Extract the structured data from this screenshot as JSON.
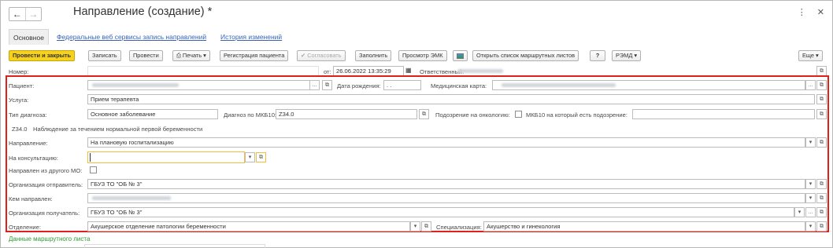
{
  "window": {
    "title": "Направление (создание) *",
    "nav_back_icon": "arrow-left-icon",
    "nav_forward_icon": "arrow-right-icon",
    "menu_glyph": "⋮",
    "close_glyph": "✕"
  },
  "tabs": {
    "main": "Основное",
    "fed": "Федеральные веб сервисы запись направлений",
    "history": "История изменений"
  },
  "toolbar": {
    "post_close": "Провести и закрыть",
    "save": "Записать",
    "post": "Провести",
    "print": "Печать",
    "register_patient": "Регистрация пациента",
    "agree": "Согласовать",
    "fill": "Заполнить",
    "view_emk": "Просмотр ЭМК",
    "open_routes": "Открыть список маршрутных листов",
    "help": "?",
    "remd": "РЭМД",
    "more": "Еще"
  },
  "header_row": {
    "number_label": "Номер:",
    "from_label": "от:",
    "datetime": "26.06.2022 13:35:29",
    "responsible_label": "Ответственный:"
  },
  "form": {
    "patient_label": "Пациент:",
    "birth_label": "Дата рождения:",
    "birth_value": ". .",
    "medcard_label": "Медицинская карта:",
    "service_label": "Услуга:",
    "service_value": "Прием терапевта",
    "diag_type_label": "Тип диагноза:",
    "diag_type_value": "Основное заболевание",
    "mkb_label": "Диагноз по МКБ10:",
    "mkb_value": "Z34.0",
    "onco_label": "Подозрение на онкологию:",
    "onco_mkb_label": "МКБ10 на который есть подозрение:",
    "diag_code": "Z34.0",
    "diag_text": "Наблюдение за течением нормальной первой беременности",
    "direction_label": "Направление:",
    "direction_value": "На плановую госпитализацию",
    "consult_label": "На консультацию:",
    "consult_value": "",
    "from_other_label": "Направлен из другого МО:",
    "org_sender_label": "Организация отправитель:",
    "org_sender_value": "ГБУЗ ТО \"ОБ № 3\"",
    "directed_by_label": "Кем направлен:",
    "org_receiver_label": "Организация получатель:",
    "org_receiver_value": "ГБУЗ ТО \"ОБ № 3\"",
    "dept_label": "Отделение:",
    "dept_value": "Акушерское отделение патологии беременности",
    "spec_label": "Специализация:",
    "spec_value": "Акушерство и гинекология"
  },
  "footer": {
    "route_data": "Данные маршрутного листа"
  },
  "colors": {
    "primary_button": "#f6d21f",
    "highlight_border": "#e0201b",
    "link": "#3a63b8",
    "green_link": "#2f9a2f"
  }
}
